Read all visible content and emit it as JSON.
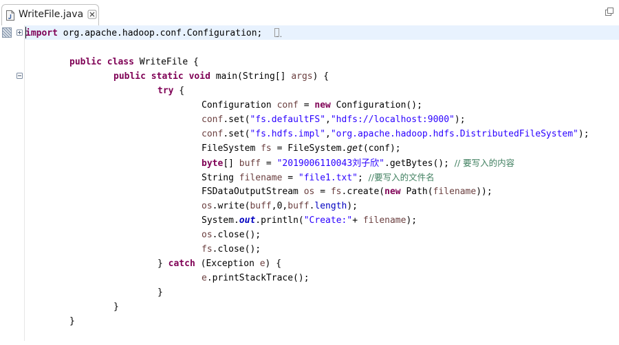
{
  "tab": {
    "label": "WriteFile.java",
    "file_icon": "java-file-icon",
    "close_icon": "close-icon"
  },
  "window": {
    "restore_icon": "restore-window-icon"
  },
  "editor": {
    "folded_marker": "..",
    "lines": {
      "l1_import": "import",
      "l1_rest": " org.apache.hadoop.conf.Configuration;",
      "l3_public": "public",
      "l3_class": "class",
      "l3_rest": " WriteFile {",
      "l4_public": "public",
      "l4_static": "static",
      "l4_void": "void",
      "l4_main": " main(String[] ",
      "l4_args": "args",
      "l4_end": ") {",
      "l5_try": "try",
      "l5_end": " {",
      "l6_a": "Configuration ",
      "l6_conf": "conf",
      "l6_b": " = ",
      "l6_new": "new",
      "l6_c": " Configuration();",
      "l7_conf": "conf",
      "l7_a": ".set(",
      "l7_s1": "\"fs.defaultFS\"",
      "l7_b": ",",
      "l7_s2": "\"hdfs://localhost:9000\"",
      "l7_c": ");",
      "l8_conf": "conf",
      "l8_a": ".set(",
      "l8_s1": "\"fs.hdfs.impl\"",
      "l8_b": ",",
      "l8_s2": "\"org.apache.hadoop.hdfs.DistributedFileSystem\"",
      "l8_c": ");",
      "l9_a": "FileSystem ",
      "l9_fs": "fs",
      "l9_b": " = FileSystem.",
      "l9_get": "get",
      "l9_c": "(conf);",
      "l10_byte": "byte",
      "l10_a": "[] ",
      "l10_buff": "buff",
      "l10_b": " = ",
      "l10_s": "\"2019006110043刘子欣\"",
      "l10_c": ".getBytes(); ",
      "l10_cmt": "// 要写入的内容",
      "l11_a": "String ",
      "l11_fn": "filename",
      "l11_b": " = ",
      "l11_s": "\"file1.txt\"",
      "l11_c": "; ",
      "l11_cmt": "//要写入的文件名",
      "l12_a": "FSDataOutputStream ",
      "l12_os": "os",
      "l12_b": " = ",
      "l12_fs": "fs",
      "l12_c": ".create(",
      "l12_new": "new",
      "l12_d": " Path(",
      "l12_fn": "filename",
      "l12_e": "));",
      "l13_os": "os",
      "l13_a": ".write(",
      "l13_buff": "buff",
      "l13_b": ",0,",
      "l13_buff2": "buff",
      "l13_c": ".",
      "l13_len": "length",
      "l13_d": ");",
      "l14_a": "System.",
      "l14_out": "out",
      "l14_b": ".println(",
      "l14_s": "\"Create:\"",
      "l14_c": "+ ",
      "l14_fn": "filename",
      "l14_d": ");",
      "l15_os": "os",
      "l15_a": ".close();",
      "l16_fs": "fs",
      "l16_a": ".close();",
      "l17_a": "} ",
      "l17_catch": "catch",
      "l17_b": " (Exception ",
      "l17_e": "e",
      "l17_c": ") {",
      "l18_e": "e",
      "l18_a": ".printStackTrace();",
      "l19": "}",
      "l20": "}",
      "l21": "}"
    }
  }
}
